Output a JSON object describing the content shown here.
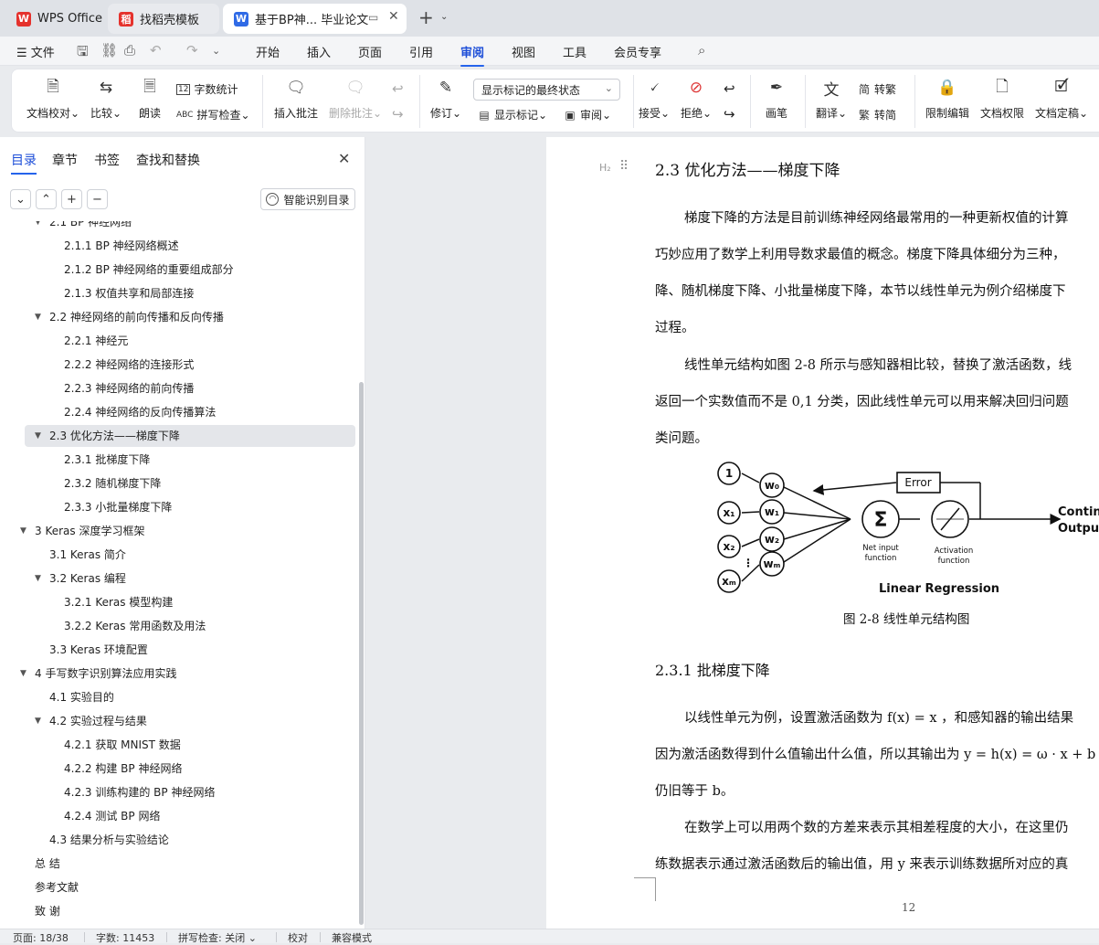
{
  "tabs": [
    {
      "label": "WPS Office",
      "logo": "W"
    },
    {
      "label": "找稻壳模板",
      "logo": "稻"
    },
    {
      "label": "基于BP神... 毕业论文",
      "logo": "W"
    }
  ],
  "menu": {
    "file": "文件",
    "items": [
      "开始",
      "插入",
      "页面",
      "引用",
      "审阅",
      "视图",
      "工具",
      "会员专享"
    ],
    "active": "审阅"
  },
  "ribbon": {
    "doc_proof": "文档校对",
    "compare": "比较",
    "read_aloud": "朗读",
    "word_count": "字数统计",
    "spell_check": "拼写检查",
    "insert_comment": "插入批注",
    "delete_comment": "删除批注",
    "revise": "修订",
    "markup_select": "显示标记的最终状态",
    "show_markup": "显示标记",
    "review": "审阅",
    "accept": "接受",
    "reject": "拒绝",
    "pen": "画笔",
    "translate": "翻译",
    "to_traditional": "转繁",
    "to_simplified": "转简",
    "restrict_edit": "限制编辑",
    "doc_permission": "文档权限",
    "doc_finalize": "文档定稿"
  },
  "nav": {
    "tabs": [
      "目录",
      "章节",
      "书签",
      "查找和替换"
    ],
    "active_tab": "目录",
    "smart_toc": "智能识别目录",
    "toc": [
      {
        "text": "2.1 BP 神经网络",
        "level": 2,
        "arrow": true
      },
      {
        "text": "2.1.1 BP 神经网络概述",
        "level": 3
      },
      {
        "text": "2.1.2 BP 神经网络的重要组成部分",
        "level": 3
      },
      {
        "text": "2.1.3  权值共享和局部连接",
        "level": 3
      },
      {
        "text": "2.2  神经网络的前向传播和反向传播",
        "level": 2,
        "arrow": true
      },
      {
        "text": "2.2.1  神经元",
        "level": 3
      },
      {
        "text": "2.2.2  神经网络的连接形式",
        "level": 3
      },
      {
        "text": "2.2.3  神经网络的前向传播",
        "level": 3
      },
      {
        "text": "2.2.4  神经网络的反向传播算法",
        "level": 3
      },
      {
        "text": "2.3  优化方法——梯度下降",
        "level": 2,
        "arrow": true,
        "selected": true
      },
      {
        "text": "2.3.1  批梯度下降",
        "level": 3
      },
      {
        "text": "2.3.2  随机梯度下降",
        "level": 3
      },
      {
        "text": "2.3.3  小批量梯度下降",
        "level": 3
      },
      {
        "text": "3 Keras 深度学习框架",
        "level": 1,
        "arrow": true
      },
      {
        "text": "3.1 Keras 简介",
        "level": 2
      },
      {
        "text": "3.2 Keras 编程",
        "level": 2,
        "arrow": true
      },
      {
        "text": "3.2.1 Keras 模型构建",
        "level": 3
      },
      {
        "text": "3.2.2 Keras 常用函数及用法",
        "level": 3
      },
      {
        "text": "3.3 Keras 环境配置",
        "level": 2
      },
      {
        "text": "4  手写数字识别算法应用实践",
        "level": 1,
        "arrow": true
      },
      {
        "text": "4.1 实验目的",
        "level": 2
      },
      {
        "text": "4.2 实验过程与结果",
        "level": 2,
        "arrow": true
      },
      {
        "text": "4.2.1 获取 MNIST 数据",
        "level": 3
      },
      {
        "text": "4.2.2 构建 BP 神经网络",
        "level": 3
      },
      {
        "text": "4.2.3 训练构建的 BP 神经网络",
        "level": 3
      },
      {
        "text": "4.2.4 测试 BP 网络",
        "level": 3
      },
      {
        "text": "4.3 结果分析与实验结论",
        "level": 2
      },
      {
        "text": "总    结",
        "level": 1
      },
      {
        "text": "参考文献",
        "level": 1
      },
      {
        "text": "致    谢",
        "level": 1
      }
    ]
  },
  "document": {
    "heading_marker": "H₂",
    "heading": "2.3  优化方法——梯度下降",
    "paragraphs": [
      "梯度下降的方法是目前训练神经网络最常用的一种更新权值的计算",
      "巧妙应用了数学上利用导数求最值的概念。梯度下降具体细分为三种，",
      "降、随机梯度下降、小批量梯度下降，本节以线性单元为例介绍梯度下",
      "过程。",
      "线性单元结构如图 2-8 所示与感知器相比较，替换了激活函数，线",
      "返回一个实数值而不是 0,1 分类，因此线性单元可以用来解决回归问题",
      "类问题。"
    ],
    "figure": {
      "inputs": [
        "1",
        "x₁",
        "x₂",
        "xₘ"
      ],
      "weights": [
        "w₀",
        "w₁",
        "w₂",
        "wₘ"
      ],
      "dots": "⋮",
      "error_label": "Error",
      "sum_symbol": "Σ",
      "net_input_label": [
        "Net input",
        "function"
      ],
      "activation_label": [
        "Activation",
        "function"
      ],
      "output_label": [
        "Contin",
        "Outpu"
      ],
      "title": "Linear Regression"
    },
    "caption": "图 2-8  线性单元结构图",
    "subheading": "2.3.1  批梯度下降",
    "paragraphs2": [
      "以线性单元为例，设置激活函数为 f(x) = x ，和感知器的输出结果",
      "因为激活函数得到什么值输出什么值，所以其输出为 y = h(x) = ω · x + b",
      "仍旧等于 b。",
      "在数学上可以用两个数的方差来表示其相差程度的大小，在这里仍",
      "练数据表示通过激活函数后的输出值，用 y 来表示训练数据所对应的真"
    ],
    "page_number": "12"
  },
  "status": {
    "page": "页面: 18/38",
    "words": "字数: 11453",
    "spell": "拼写检查: 关闭",
    "proof": "校对",
    "compat": "兼容模式"
  },
  "colors": {
    "accent": "#2563eb",
    "wps_red": "#e5322d"
  }
}
